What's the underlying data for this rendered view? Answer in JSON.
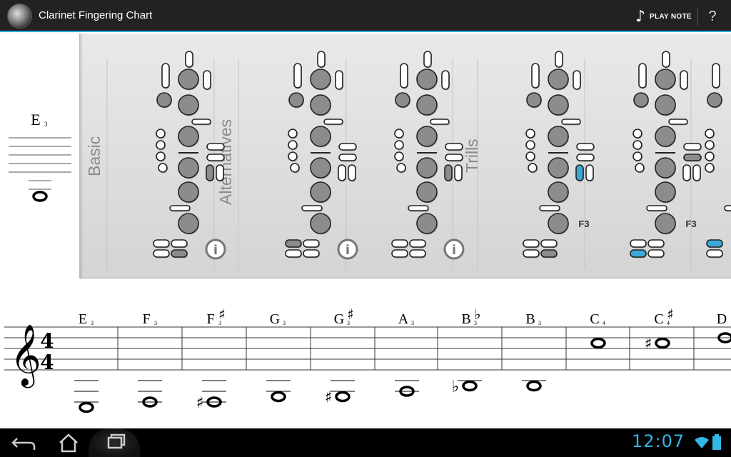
{
  "app": {
    "title": "Clarinet Fingering Chart",
    "play_note_label": "PLAY NOTE",
    "help_label": "?"
  },
  "current_note": {
    "letter": "E",
    "octave": "3"
  },
  "sections": [
    {
      "label": "Basic"
    },
    {
      "label": "Alternatives"
    },
    {
      "label": "Trills"
    }
  ],
  "trill_labels": [
    "F3",
    "F3"
  ],
  "staff_notes": [
    {
      "letter": "E",
      "octave": "3",
      "accidental": ""
    },
    {
      "letter": "F",
      "octave": "3",
      "accidental": ""
    },
    {
      "letter": "F",
      "octave": "3",
      "accidental": "♯"
    },
    {
      "letter": "G",
      "octave": "3",
      "accidental": ""
    },
    {
      "letter": "G",
      "octave": "3",
      "accidental": "♯"
    },
    {
      "letter": "A",
      "octave": "3",
      "accidental": ""
    },
    {
      "letter": "B",
      "octave": "3",
      "accidental": "♭"
    },
    {
      "letter": "B",
      "octave": "3",
      "accidental": ""
    },
    {
      "letter": "C",
      "octave": "4",
      "accidental": ""
    },
    {
      "letter": "C",
      "octave": "4",
      "accidental": "♯"
    },
    {
      "letter": "D",
      "octave": "",
      "accidental": ""
    }
  ],
  "time_signature": {
    "top": "4",
    "bottom": "4"
  },
  "status": {
    "clock": "12:07"
  },
  "colors": {
    "accent": "#33b5e5",
    "key_closed": "#8c8c8c",
    "trill_key": "#3aa9d9"
  }
}
